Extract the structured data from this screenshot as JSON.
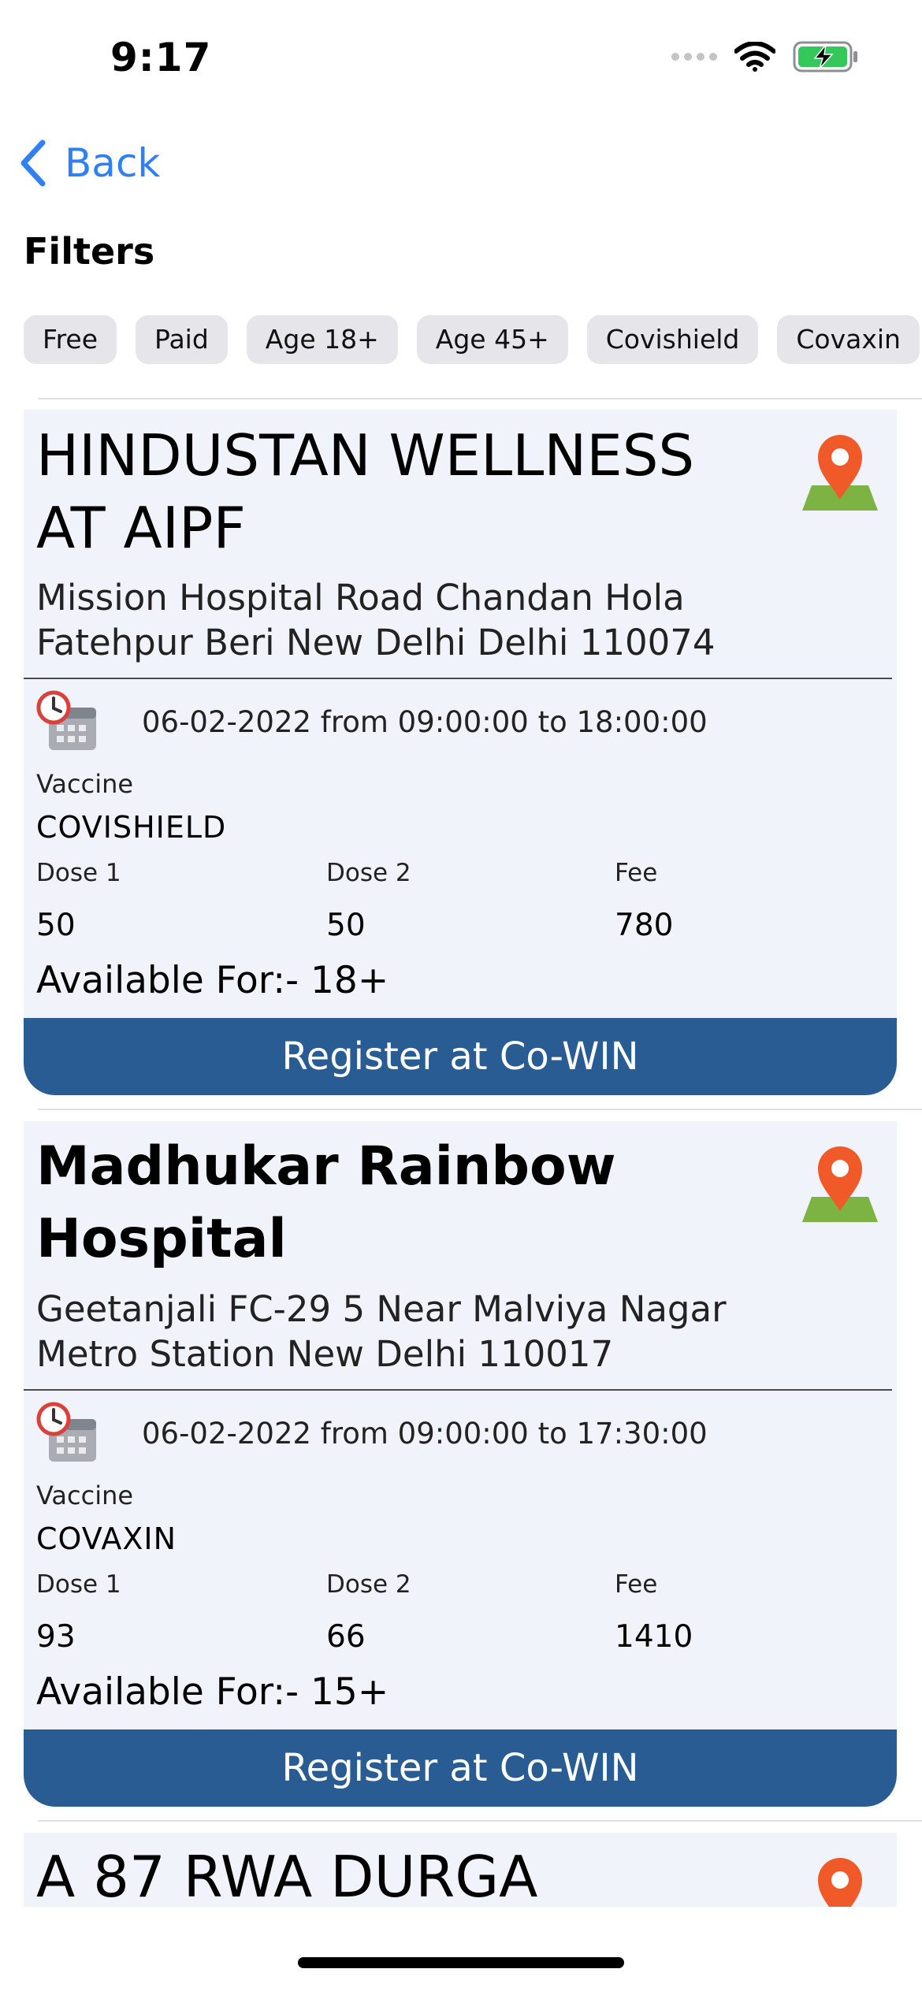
{
  "status_bar": {
    "time": "9:17",
    "battery_color": "#34c759"
  },
  "nav": {
    "back_label": "Back",
    "accent": "#2f7ff5"
  },
  "filters": {
    "title": "Filters",
    "chips": [
      "Free",
      "Paid",
      "Age 18+",
      "Age 45+",
      "Covishield",
      "Covaxin"
    ]
  },
  "centers": [
    {
      "name": "HINDUSTAN WELLNESS AT AIPF",
      "address": "Mission Hospital Road Chandan Hola Fatehpur Beri New Delhi Delhi 110074",
      "schedule": "06-02-2022 from 09:00:00 to 18:00:00",
      "vaccine_label": "Vaccine",
      "vaccine": "COVISHIELD",
      "dose1_label": "Dose 1",
      "dose2_label": "Dose 2",
      "fee_label": "Fee",
      "dose1": "50",
      "dose2": "50",
      "fee": "780",
      "available": "Available For:- 18+",
      "register_label": "Register at Co-WIN"
    },
    {
      "name": "Madhukar Rainbow Hospital",
      "address": "Geetanjali FC-29 5 Near Malviya Nagar Metro Station New Delhi 110017",
      "schedule": "06-02-2022 from 09:00:00 to 17:30:00",
      "vaccine_label": "Vaccine",
      "vaccine": "COVAXIN",
      "dose1_label": "Dose 1",
      "dose2_label": "Dose 2",
      "fee_label": "Fee",
      "dose1": "93",
      "dose2": "66",
      "fee": "1410",
      "available": "Available For:- 15+",
      "register_label": "Register at Co-WIN"
    },
    {
      "name": "A 87 RWA DURGA"
    }
  ],
  "colors": {
    "card_bg": "#f0f3fa",
    "button": "#2a5c94",
    "pin": "#f05a28",
    "map": "#7cb342"
  }
}
